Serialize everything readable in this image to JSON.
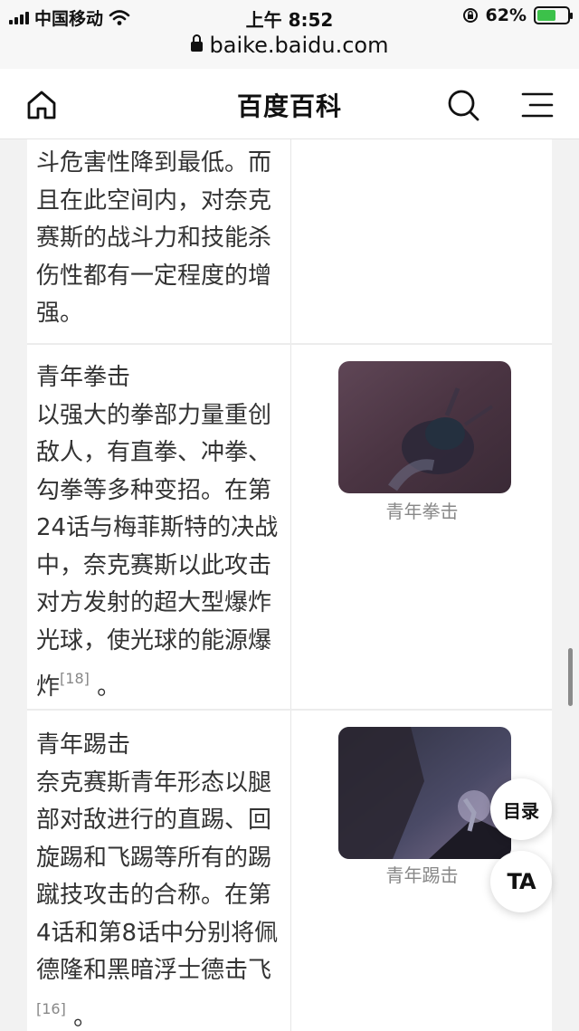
{
  "status_bar": {
    "carrier": "中国移动",
    "time": "上午 8:52",
    "battery": "62%",
    "battery_level": 0.62
  },
  "url_bar": {
    "domain": "baike.baidu.com"
  },
  "header": {
    "title": "百度百科",
    "icons": [
      "home-icon",
      "search-icon",
      "menu-icon"
    ]
  },
  "table": {
    "rows": [
      {
        "text": "斗危害性降到最低。而且在此空间内，对奈克赛斯的战斗力和技能杀伤性都有一定程度的增强。"
      },
      {
        "heading": "青年拳击",
        "text": "以强大的拳部力量重创敌人，有直拳、冲拳、勾拳等多种变招。在第24话与梅菲斯特的决战中，奈克赛斯以此攻击对方发射的超大型爆炸光球，使光球的能源爆炸",
        "ref": "[18]",
        "tail": " 。",
        "image_caption": "青年拳击"
      },
      {
        "heading": "青年踢击",
        "text": "奈克赛斯青年形态以腿部对敌进行的直踢、回旋踢和飞踢等所有的踢蹴技攻击的合称。在第4话和第8话中分别将佩德隆和黑暗浮士德击飞",
        "ref": "[16]",
        "tail": " 。",
        "image_caption": "青年踢击"
      }
    ]
  },
  "floating": {
    "toc_label": "目录",
    "ta_label": "TA"
  },
  "colors": {
    "accent_green": "#3cc14a",
    "caption_gray": "#888888"
  }
}
